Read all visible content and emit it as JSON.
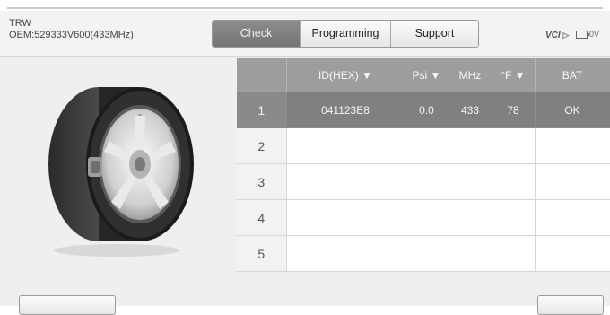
{
  "header": {
    "make": "TRW",
    "oem": "OEM:529333V600(433MHz)"
  },
  "tabs": [
    {
      "label": "Check",
      "active": true
    },
    {
      "label": "Programming",
      "active": false
    },
    {
      "label": "Support",
      "active": false
    }
  ],
  "status": {
    "vci_label": "VCI",
    "vci_arrow": "▷",
    "battery_label": "0V"
  },
  "table": {
    "headers": [
      "",
      "ID(HEX) ▼",
      "Psi ▼",
      "MHz",
      "°F ▼",
      "BAT"
    ],
    "rows": [
      [
        "1",
        "041123E8",
        "0.0",
        "433",
        "78",
        "OK"
      ],
      [
        "2",
        "",
        "",
        "",
        "",
        ""
      ],
      [
        "3",
        "",
        "",
        "",
        "",
        ""
      ],
      [
        "4",
        "",
        "",
        "",
        "",
        ""
      ],
      [
        "5",
        "",
        "",
        "",
        "",
        ""
      ]
    ],
    "selected_row": 0
  },
  "colors": {
    "tab_active": "#808080",
    "row_selected": "#808080",
    "header_bg": "#9d9d9d"
  }
}
